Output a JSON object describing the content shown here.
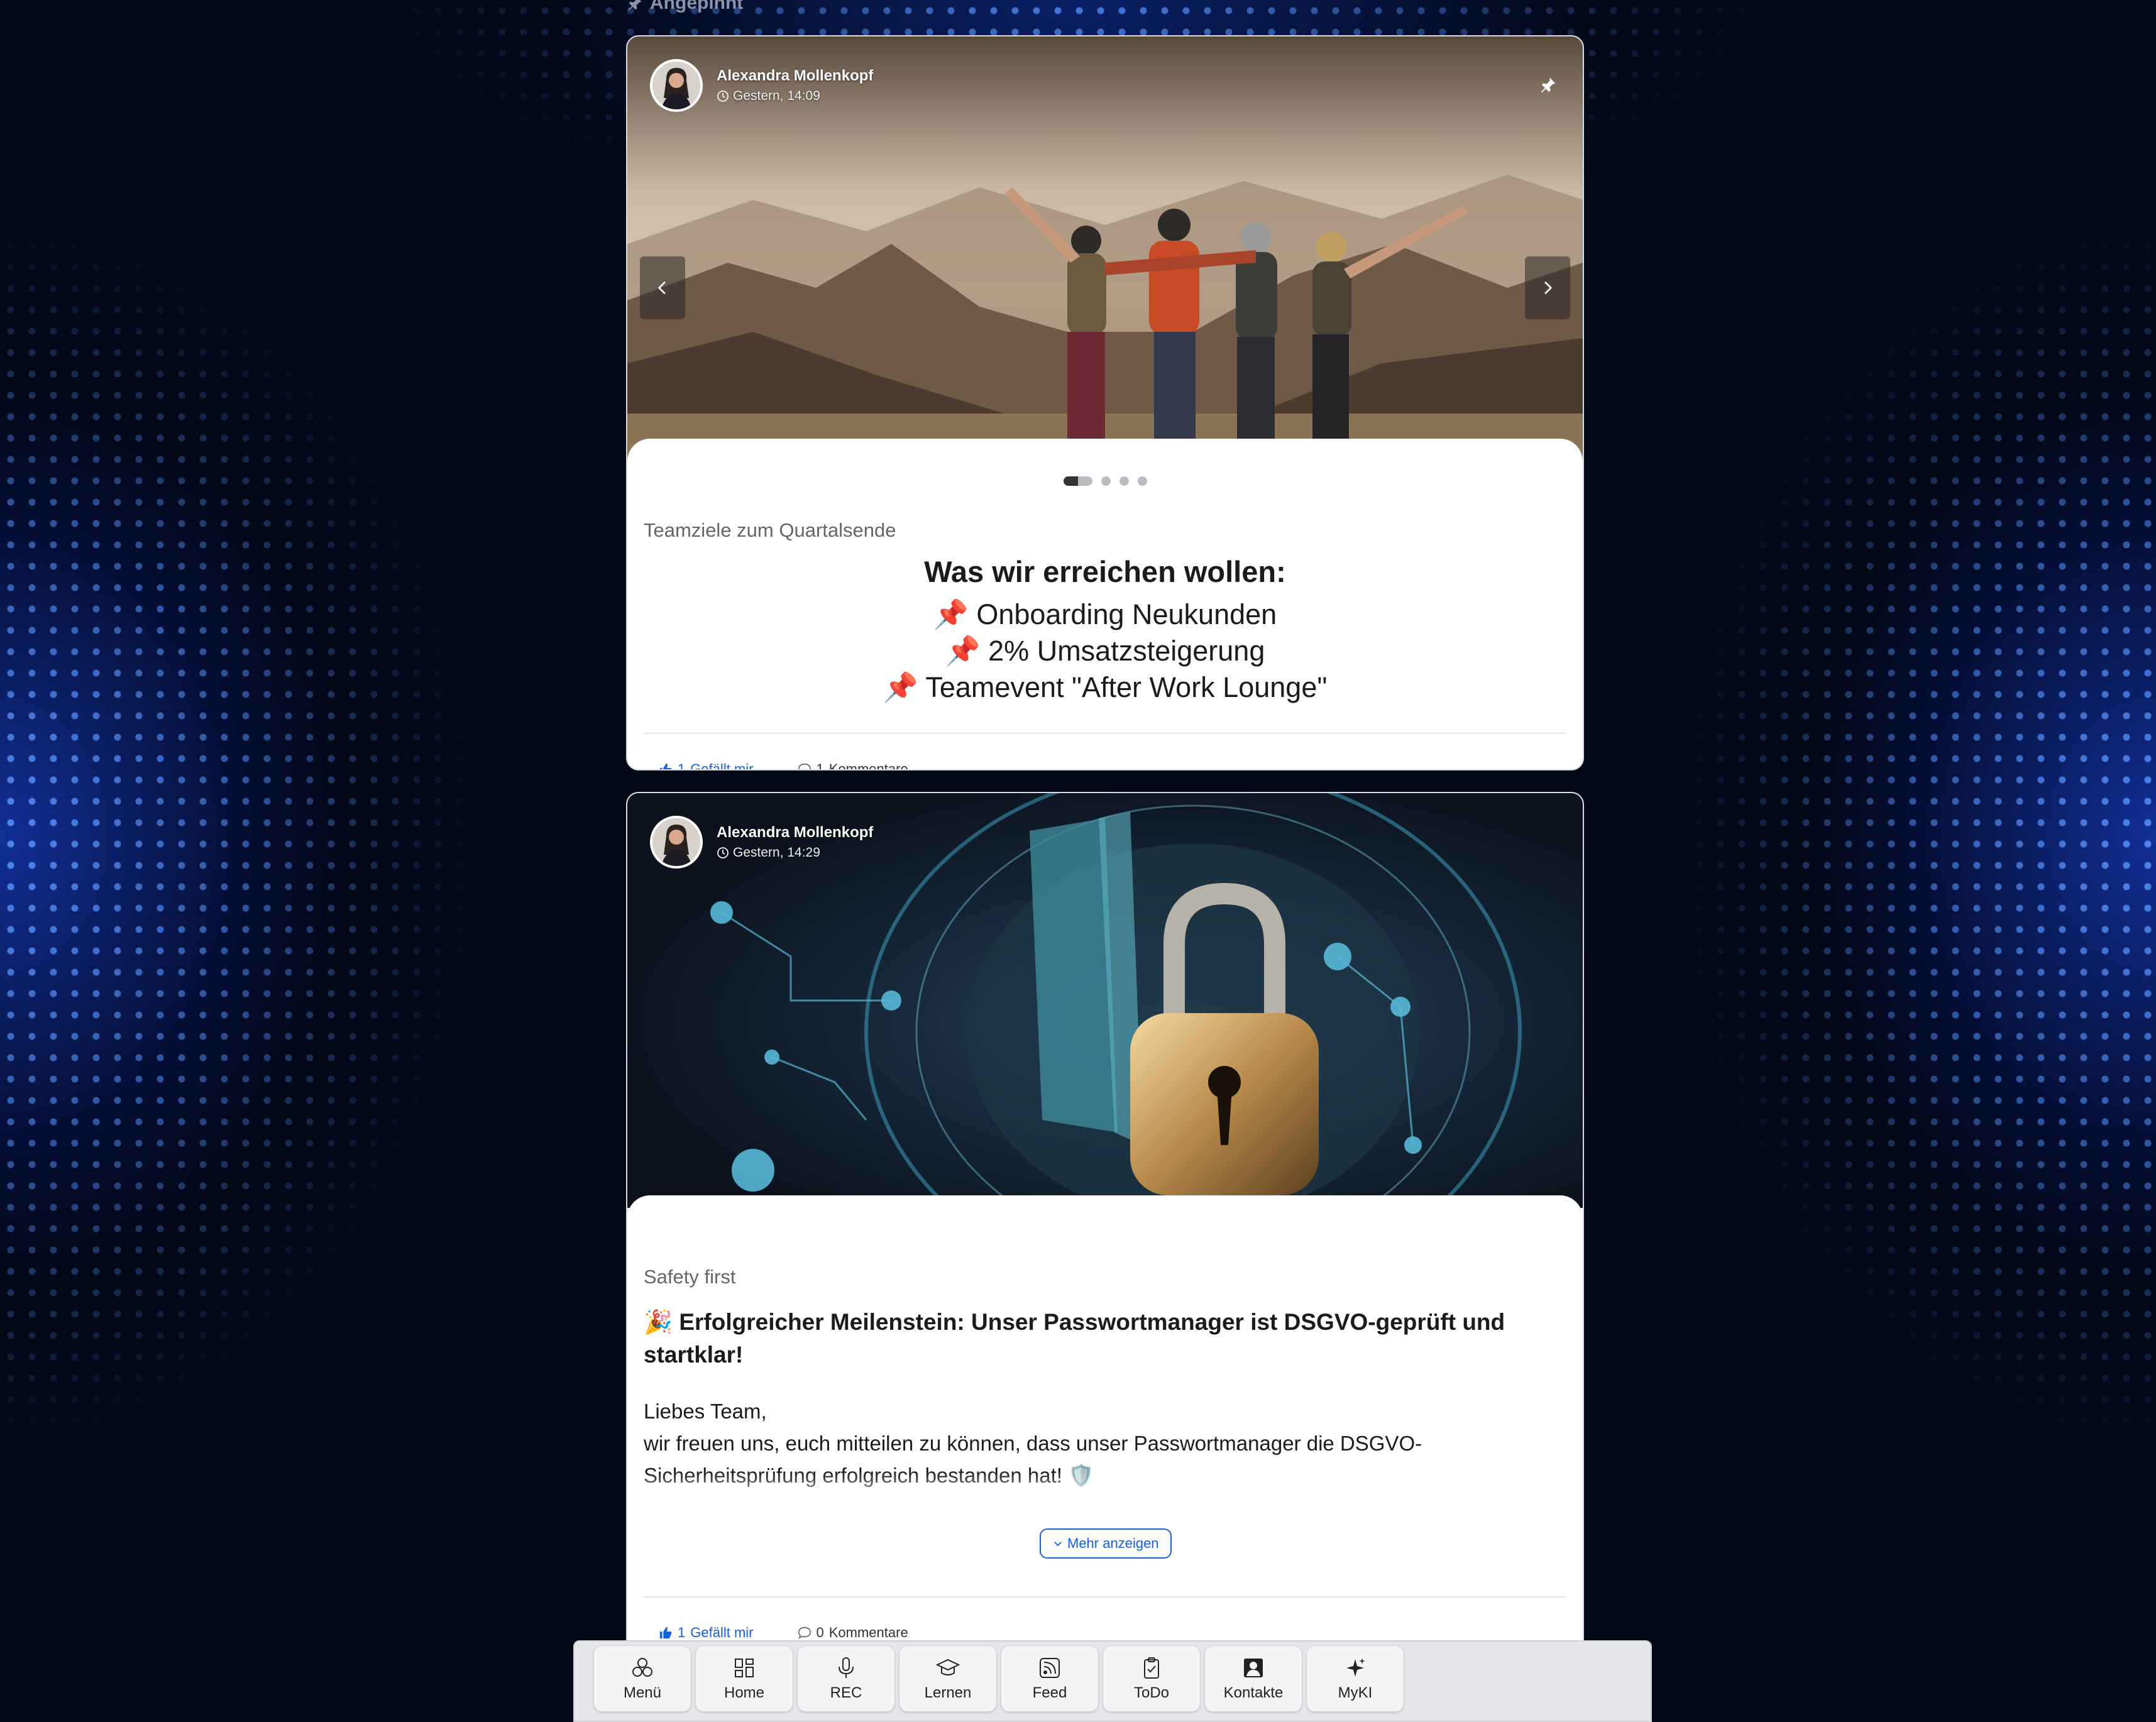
{
  "pinned_section": {
    "label": "Angepinnt"
  },
  "posts": [
    {
      "author": "Alexandra Mollenkopf",
      "time": "Gestern, 14:09",
      "subtitle": "Teamziele zum Quartalsende",
      "heading": "Was wir erreichen wollen:",
      "goals": [
        "📌 Onboarding Neukunden",
        "📌 2% Umsatzsteigerung",
        "📌 Teamevent \"After Work Lounge\""
      ],
      "likes": "1",
      "like_label": "Gefällt mir",
      "comments": "1",
      "comment_label": "Kommentare"
    },
    {
      "author": "Alexandra Mollenkopf",
      "time": "Gestern, 14:29",
      "subtitle": "Safety first",
      "title": "🎉 Erfolgreicher Meilenstein: Unser Passwortmanager ist DSGVO-geprüft und startklar!",
      "body_line1": "Liebes Team,",
      "body_line2": "wir freuen uns, euch mitteilen zu können, dass unser Passwortmanager die DSGVO-Sicherheitsprüfung erfolgreich bestanden hat! 🛡️",
      "more_label": "Mehr anzeigen",
      "likes": "1",
      "like_label": "Gefällt mir",
      "comments": "0",
      "comment_label": "Kommentare"
    }
  ],
  "dock": [
    {
      "label": "Menü",
      "icon": "menu-icon"
    },
    {
      "label": "Home",
      "icon": "home-grid-icon"
    },
    {
      "label": "REC",
      "icon": "microphone-icon"
    },
    {
      "label": "Lernen",
      "icon": "graduation-cap-icon"
    },
    {
      "label": "Feed",
      "icon": "rss-icon"
    },
    {
      "label": "ToDo",
      "icon": "clipboard-icon"
    },
    {
      "label": "Kontakte",
      "icon": "contact-icon"
    },
    {
      "label": "MyKI",
      "icon": "sparkles-icon"
    }
  ],
  "colors": {
    "accent": "#1660d8",
    "background": "#020816"
  }
}
